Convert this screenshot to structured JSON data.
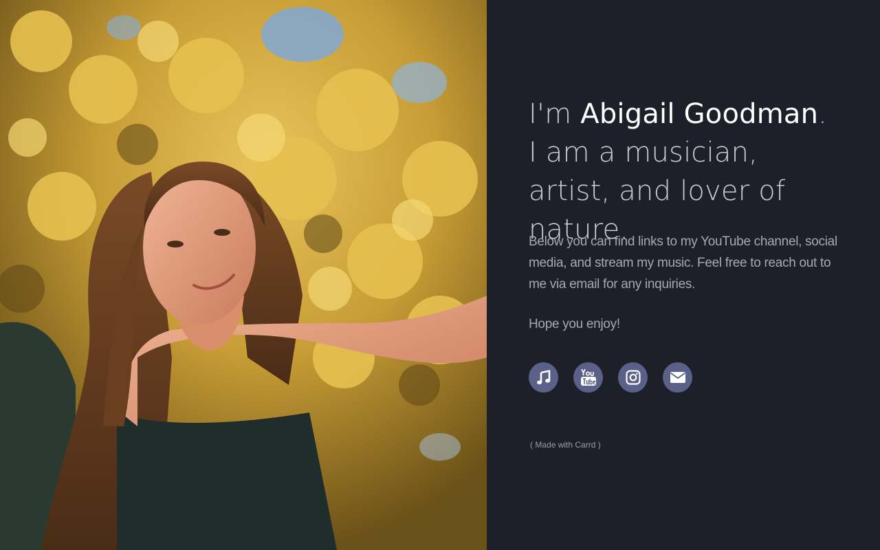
{
  "headline": {
    "prefix": "I'm ",
    "name": "Abigail Goodman",
    "suffix": ". I am a musician, artist, and lover of nature."
  },
  "intro": "Below you can find links to my YouTube channel, social media, and stream my music. Feel free to reach out to me via email for any inquiries.",
  "outro": "Hope you enjoy!",
  "social_links": [
    {
      "icon": "music-note-icon"
    },
    {
      "icon": "youtube-icon"
    },
    {
      "icon": "instagram-icon"
    },
    {
      "icon": "envelope-icon"
    }
  ],
  "credit": {
    "open": "(",
    "label": "Made with Carrd",
    "close": ")"
  },
  "colors": {
    "background": "#1e2029",
    "icon_circle": "#5a6088",
    "name_text": "#ffffff",
    "body_text": "#a6a8b6"
  }
}
